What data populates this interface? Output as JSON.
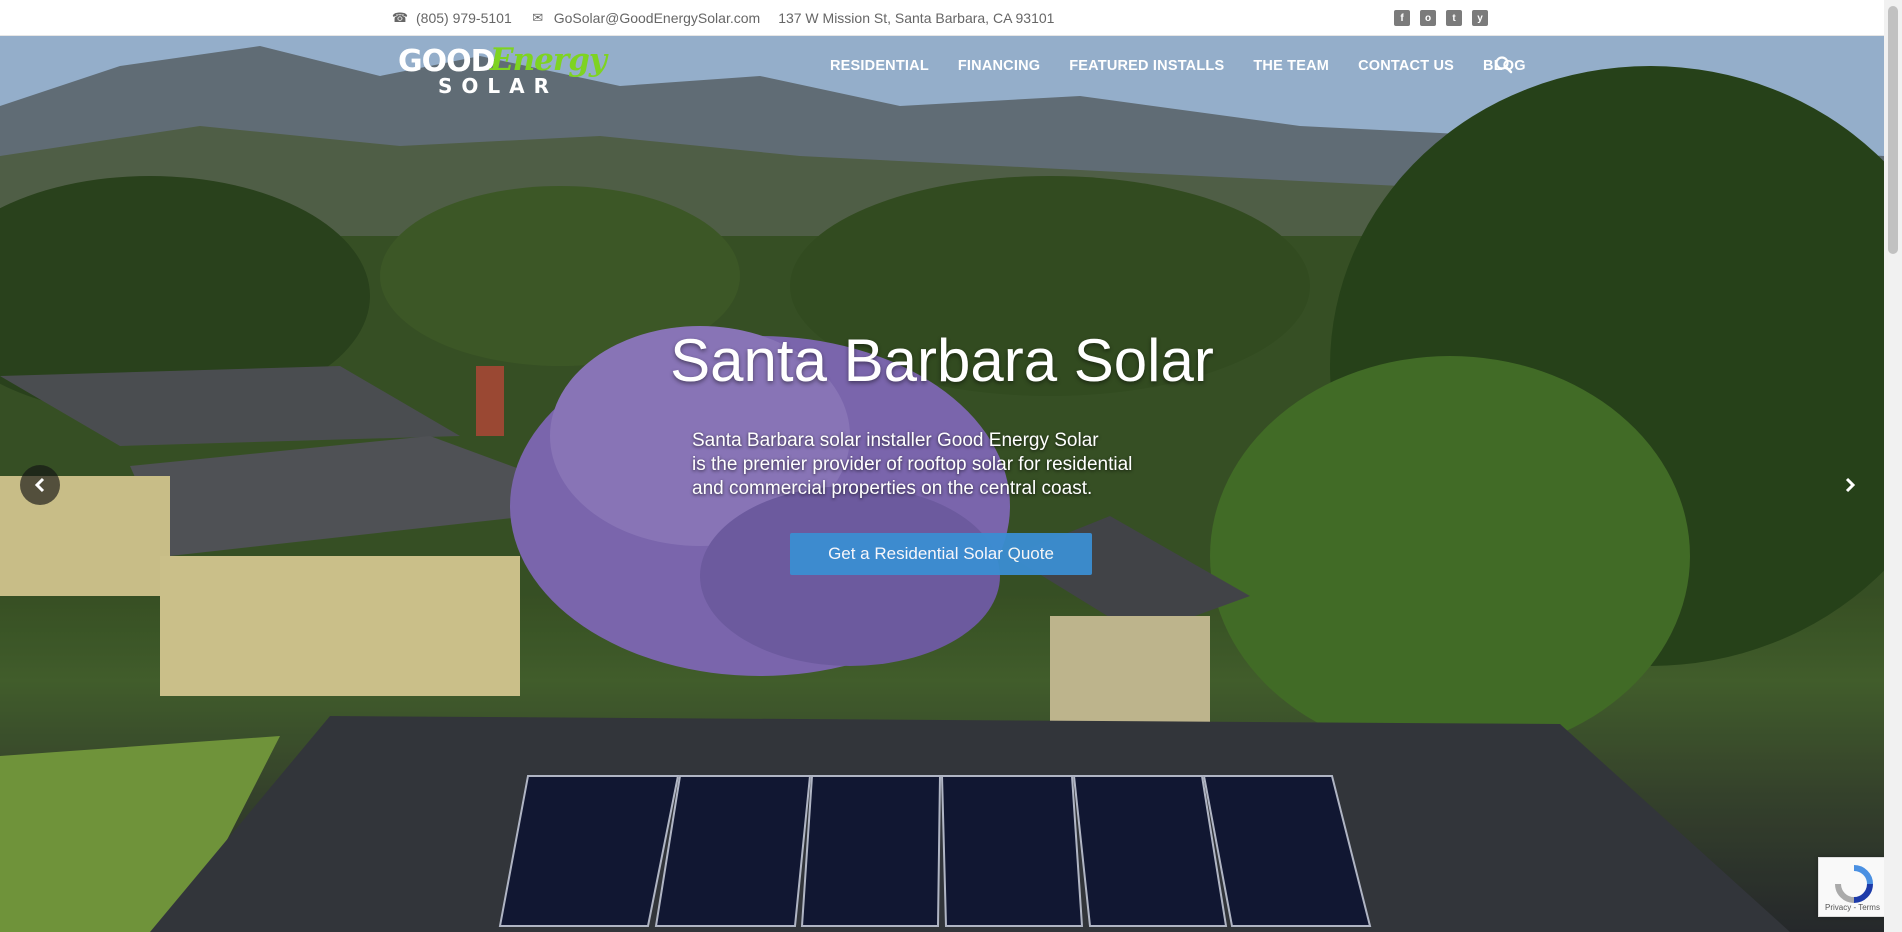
{
  "topbar": {
    "phone": "(805) 979-5101",
    "email": "GoSolar@GoodEnergySolar.com",
    "address": "137 W Mission St, Santa Barbara, CA 93101",
    "social": [
      "f",
      "o",
      "t",
      "y"
    ]
  },
  "logo": {
    "good": "GOOD",
    "energy": "Energy",
    "solar": "SOLAR"
  },
  "nav": {
    "residential": "RESIDENTIAL",
    "financing": "FINANCING",
    "featured": "FEATURED INSTALLS",
    "team": "THE TEAM",
    "contact": "CONTACT US",
    "blog": "BLOG"
  },
  "hero": {
    "headline": "Santa Barbara Solar",
    "subtext_line1": "Santa Barbara solar installer Good Energy Solar",
    "subtext_line2": "is the premier provider of rooftop solar for residential",
    "subtext_line3": "and commercial properties on the central coast.",
    "cta": "Get a Residential Solar Quote"
  },
  "recaptcha": {
    "links": "Privacy - Terms"
  },
  "colors": {
    "accent": "#3b8ed2",
    "logo_green": "#7ed321"
  }
}
